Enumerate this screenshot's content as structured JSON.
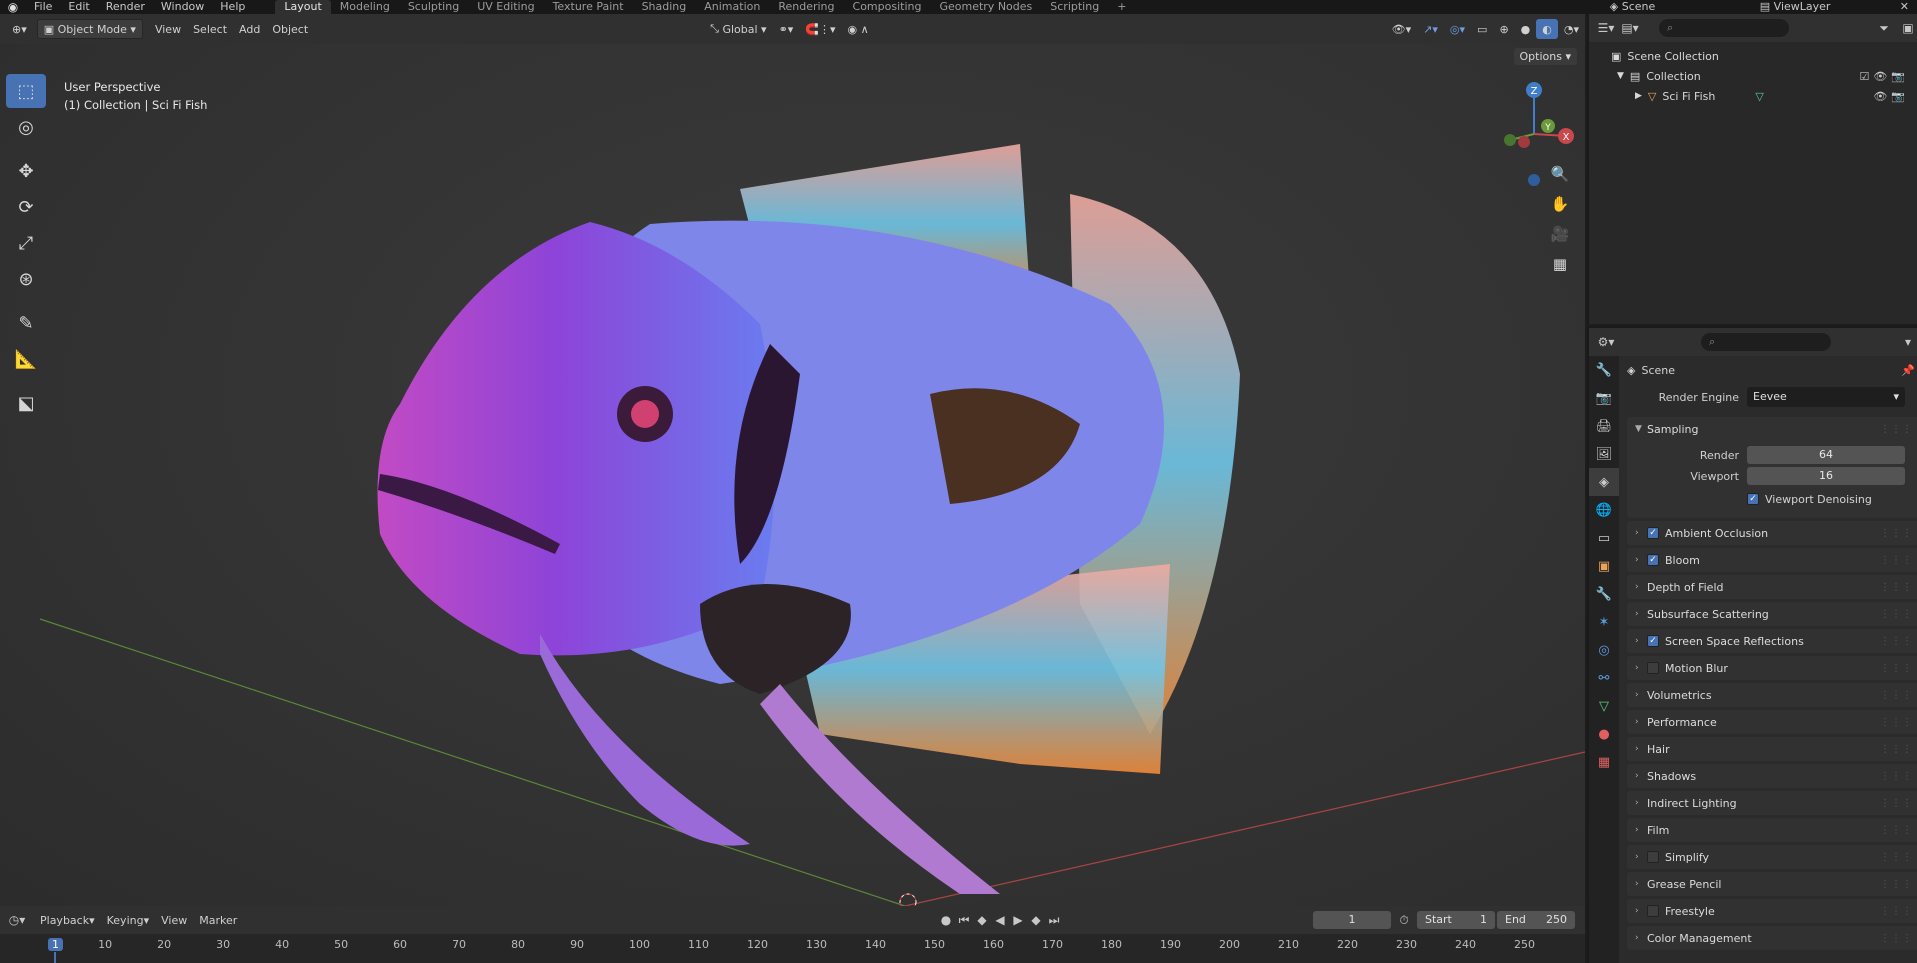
{
  "menu": {
    "items": [
      "File",
      "Edit",
      "Render",
      "Window",
      "Help"
    ],
    "workspaces": [
      "Layout",
      "Modeling",
      "Sculpting",
      "UV Editing",
      "Texture Paint",
      "Shading",
      "Animation",
      "Rendering",
      "Compositing",
      "Geometry Nodes",
      "Scripting"
    ],
    "active_workspace": "Layout",
    "add_tab": "+",
    "scene": "Scene",
    "view_layer": "ViewLayer"
  },
  "viewport_header": {
    "mode": "Object Mode",
    "menus": [
      "View",
      "Select",
      "Add",
      "Object"
    ],
    "orientation": "Global",
    "options": "Options"
  },
  "viewport": {
    "perspective": "User Perspective",
    "collection_info": "(1) Collection | Sci Fi Fish",
    "gizmo_z": "Z",
    "gizmo_y": "Y",
    "gizmo_x": "X"
  },
  "outliner": {
    "rows": [
      {
        "label": "Scene Collection"
      },
      {
        "label": "Collection"
      },
      {
        "label": "Sci Fi Fish"
      }
    ]
  },
  "properties": {
    "context": "Scene",
    "render_engine_label": "Render Engine",
    "render_engine": "Eevee",
    "sampling": "Sampling",
    "render_label": "Render",
    "render_samples": "64",
    "viewport_label": "Viewport",
    "viewport_samples": "16",
    "viewport_denoising": "Viewport Denoising",
    "sections": [
      {
        "label": "Ambient Occlusion",
        "checkbox": true,
        "checked": true
      },
      {
        "label": "Bloom",
        "checkbox": true,
        "checked": true
      },
      {
        "label": "Depth of Field",
        "checkbox": false
      },
      {
        "label": "Subsurface Scattering",
        "checkbox": false
      },
      {
        "label": "Screen Space Reflections",
        "checkbox": true,
        "checked": true
      },
      {
        "label": "Motion Blur",
        "checkbox": true,
        "checked": false
      },
      {
        "label": "Volumetrics",
        "checkbox": false
      },
      {
        "label": "Performance",
        "checkbox": false
      },
      {
        "label": "Hair",
        "checkbox": false
      },
      {
        "label": "Shadows",
        "checkbox": false
      },
      {
        "label": "Indirect Lighting",
        "checkbox": false
      },
      {
        "label": "Film",
        "checkbox": false
      },
      {
        "label": "Simplify",
        "checkbox": true,
        "checked": false
      },
      {
        "label": "Grease Pencil",
        "checkbox": false
      },
      {
        "label": "Freestyle",
        "checkbox": true,
        "checked": false
      },
      {
        "label": "Color Management",
        "checkbox": false
      }
    ]
  },
  "timeline": {
    "menus": [
      "Playback",
      "Keying",
      "View",
      "Marker"
    ],
    "current_frame": "1",
    "start_label": "Start",
    "start": "1",
    "end_label": "End",
    "end": "250",
    "ruler": [
      "1",
      "10",
      "20",
      "30",
      "40",
      "50",
      "60",
      "70",
      "80",
      "90",
      "100",
      "110",
      "120",
      "130",
      "140",
      "150",
      "160",
      "170",
      "180",
      "190",
      "200",
      "210",
      "220",
      "230",
      "240",
      "250"
    ]
  },
  "colors": {
    "accent": "#4772b3",
    "axis_x": "#c8484b",
    "axis_y": "#6a9a3a",
    "axis_z": "#3f7ec9"
  }
}
